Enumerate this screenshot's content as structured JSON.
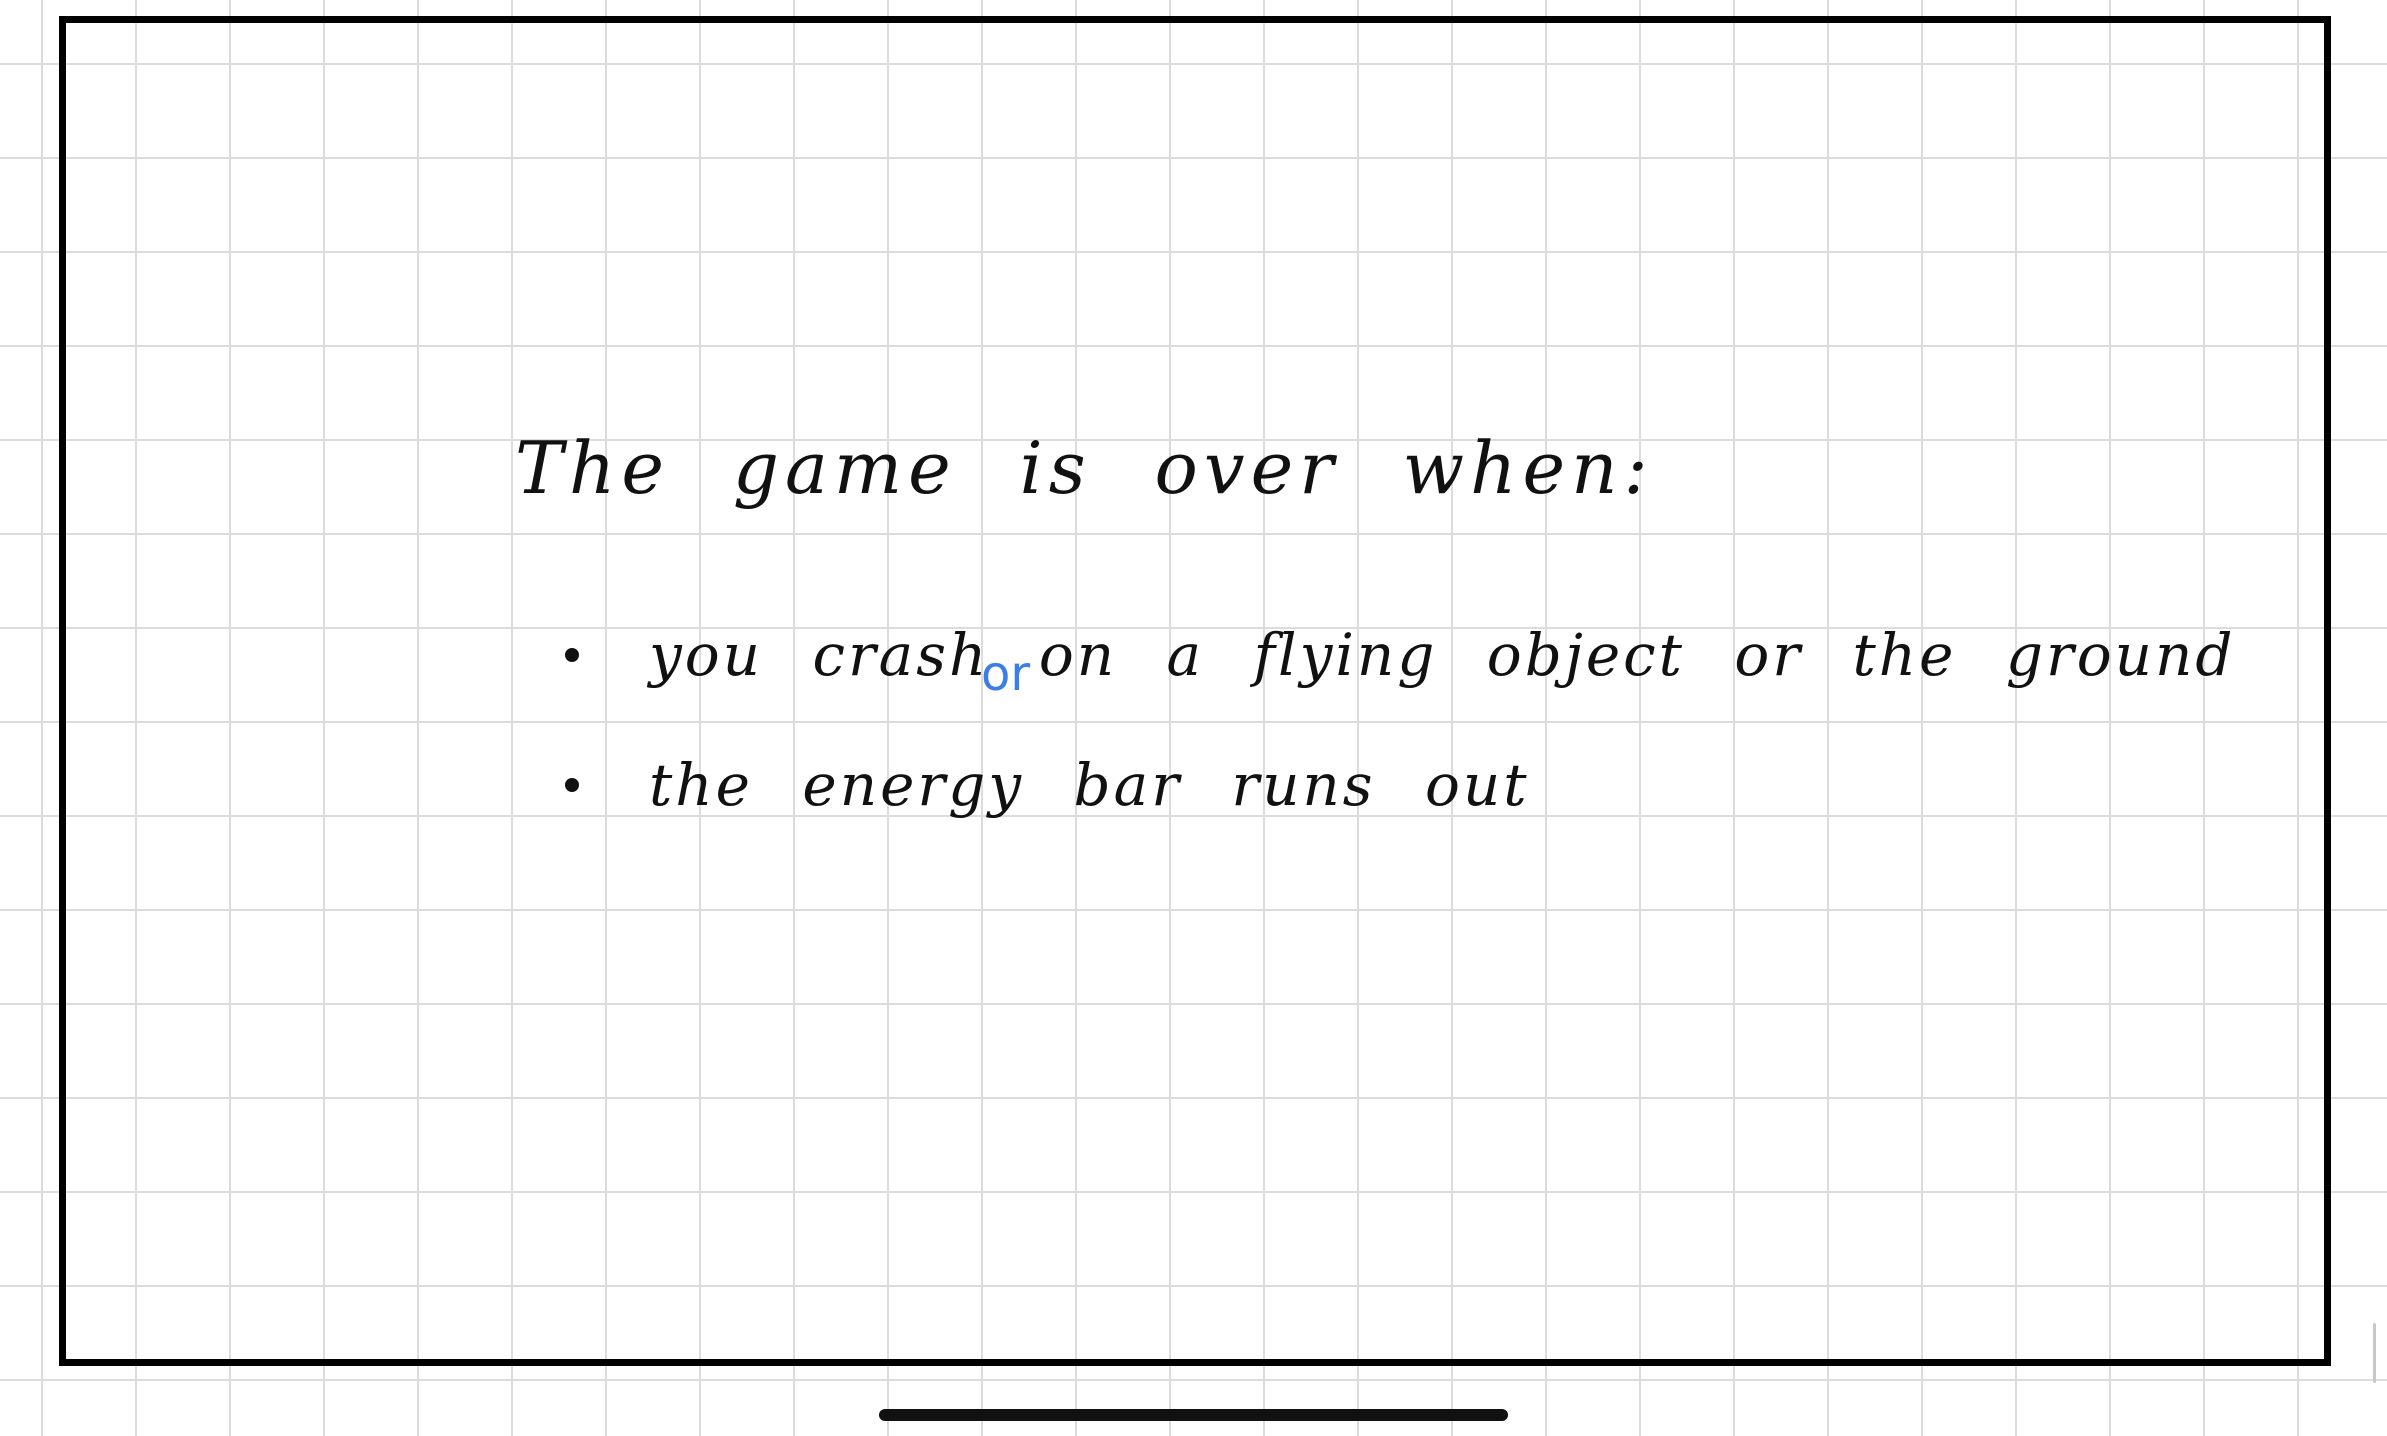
{
  "note": {
    "title": "The game is over when:",
    "bullets": [
      {
        "text": "you crash on a flying object or the ground"
      },
      {
        "text": "the energy bar runs out"
      }
    ],
    "inserted_word": "or"
  },
  "colors": {
    "ink": "#111111",
    "annotation": "#3d7ee6",
    "grid": "#dcdcdc",
    "frame": "#000000"
  }
}
